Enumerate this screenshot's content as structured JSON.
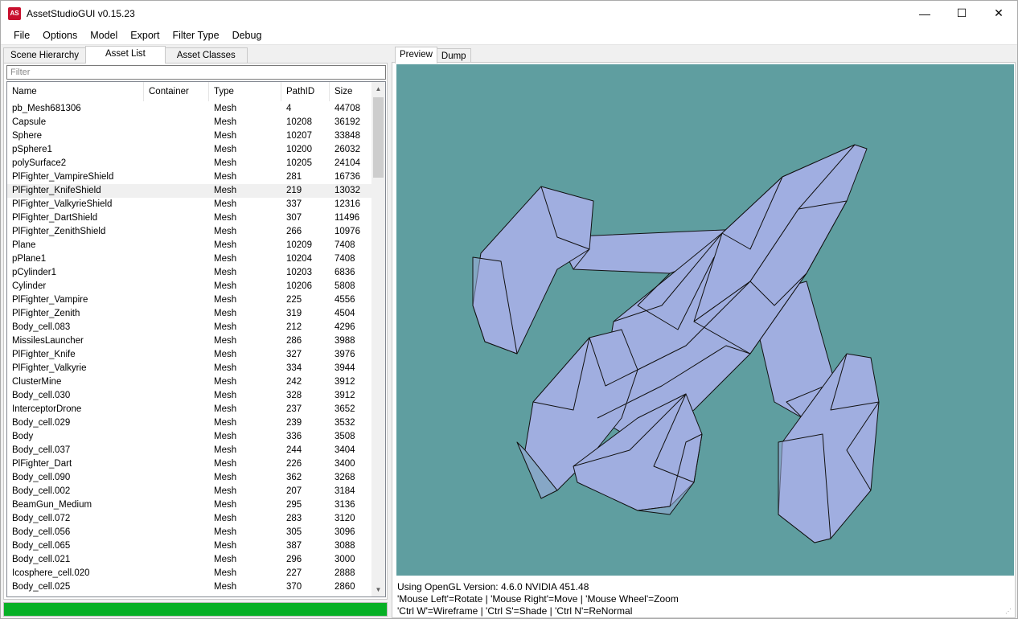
{
  "window": {
    "title": "AssetStudioGUI v0.15.23",
    "icon_text": "AS"
  },
  "window_controls": {
    "minimize": "—",
    "maximize": "☐",
    "close": "✕"
  },
  "menu": [
    "File",
    "Options",
    "Model",
    "Export",
    "Filter Type",
    "Debug"
  ],
  "left_tabs": [
    {
      "label": "Scene Hierarchy",
      "active": false
    },
    {
      "label": "Asset List",
      "active": true
    },
    {
      "label": "Asset Classes",
      "active": false
    }
  ],
  "filter": {
    "placeholder": "Filter"
  },
  "columns": [
    "Name",
    "Container",
    "Type",
    "PathID",
    "Size"
  ],
  "rows": [
    [
      "pb_Mesh681306",
      "",
      "Mesh",
      "4",
      "44708"
    ],
    [
      "Capsule",
      "",
      "Mesh",
      "10208",
      "36192"
    ],
    [
      "Sphere",
      "",
      "Mesh",
      "10207",
      "33848"
    ],
    [
      "pSphere1",
      "",
      "Mesh",
      "10200",
      "26032"
    ],
    [
      "polySurface2",
      "",
      "Mesh",
      "10205",
      "24104"
    ],
    [
      "PlFighter_VampireShield",
      "",
      "Mesh",
      "281",
      "16736"
    ],
    [
      "PlFighter_KnifeShield",
      "",
      "Mesh",
      "219",
      "13032"
    ],
    [
      "PlFighter_ValkyrieShield",
      "",
      "Mesh",
      "337",
      "12316"
    ],
    [
      "PlFighter_DartShield",
      "",
      "Mesh",
      "307",
      "11496"
    ],
    [
      "PlFighter_ZenithShield",
      "",
      "Mesh",
      "266",
      "10976"
    ],
    [
      "Plane",
      "",
      "Mesh",
      "10209",
      "7408"
    ],
    [
      "pPlane1",
      "",
      "Mesh",
      "10204",
      "7408"
    ],
    [
      "pCylinder1",
      "",
      "Mesh",
      "10203",
      "6836"
    ],
    [
      "Cylinder",
      "",
      "Mesh",
      "10206",
      "5808"
    ],
    [
      "PlFighter_Vampire",
      "",
      "Mesh",
      "225",
      "4556"
    ],
    [
      "PlFighter_Zenith",
      "",
      "Mesh",
      "319",
      "4504"
    ],
    [
      "Body_cell.083",
      "",
      "Mesh",
      "212",
      "4296"
    ],
    [
      "MissilesLauncher",
      "",
      "Mesh",
      "286",
      "3988"
    ],
    [
      "PlFighter_Knife",
      "",
      "Mesh",
      "327",
      "3976"
    ],
    [
      "PlFighter_Valkyrie",
      "",
      "Mesh",
      "334",
      "3944"
    ],
    [
      "ClusterMine",
      "",
      "Mesh",
      "242",
      "3912"
    ],
    [
      "Body_cell.030",
      "",
      "Mesh",
      "328",
      "3912"
    ],
    [
      "InterceptorDrone",
      "",
      "Mesh",
      "237",
      "3652"
    ],
    [
      "Body_cell.029",
      "",
      "Mesh",
      "239",
      "3532"
    ],
    [
      "Body",
      "",
      "Mesh",
      "336",
      "3508"
    ],
    [
      "Body_cell.037",
      "",
      "Mesh",
      "244",
      "3404"
    ],
    [
      "PlFighter_Dart",
      "",
      "Mesh",
      "226",
      "3400"
    ],
    [
      "Body_cell.090",
      "",
      "Mesh",
      "362",
      "3268"
    ],
    [
      "Body_cell.002",
      "",
      "Mesh",
      "207",
      "3184"
    ],
    [
      "BeamGun_Medium",
      "",
      "Mesh",
      "295",
      "3136"
    ],
    [
      "Body_cell.072",
      "",
      "Mesh",
      "283",
      "3120"
    ],
    [
      "Body_cell.056",
      "",
      "Mesh",
      "305",
      "3096"
    ],
    [
      "Body_cell.065",
      "",
      "Mesh",
      "387",
      "3088"
    ],
    [
      "Body_cell.021",
      "",
      "Mesh",
      "296",
      "3000"
    ],
    [
      "Icosphere_cell.020",
      "",
      "Mesh",
      "227",
      "2888"
    ],
    [
      "Body_cell.025",
      "",
      "Mesh",
      "370",
      "2860"
    ]
  ],
  "selected_row": 6,
  "progress": {
    "fraction": 1.0,
    "color": "#06b025"
  },
  "right_tabs": [
    {
      "label": "Preview",
      "active": true
    },
    {
      "label": "Dump",
      "active": false
    }
  ],
  "preview": {
    "background": "#5f9ea0",
    "model_color": "#a0aee0"
  },
  "status_lines": [
    "Using OpenGL Version: 4.6.0 NVIDIA 451.48",
    "'Mouse Left'=Rotate | 'Mouse Right'=Move | 'Mouse Wheel'=Zoom",
    "'Ctrl W'=Wireframe | 'Ctrl S'=Shade | 'Ctrl N'=ReNormal"
  ]
}
